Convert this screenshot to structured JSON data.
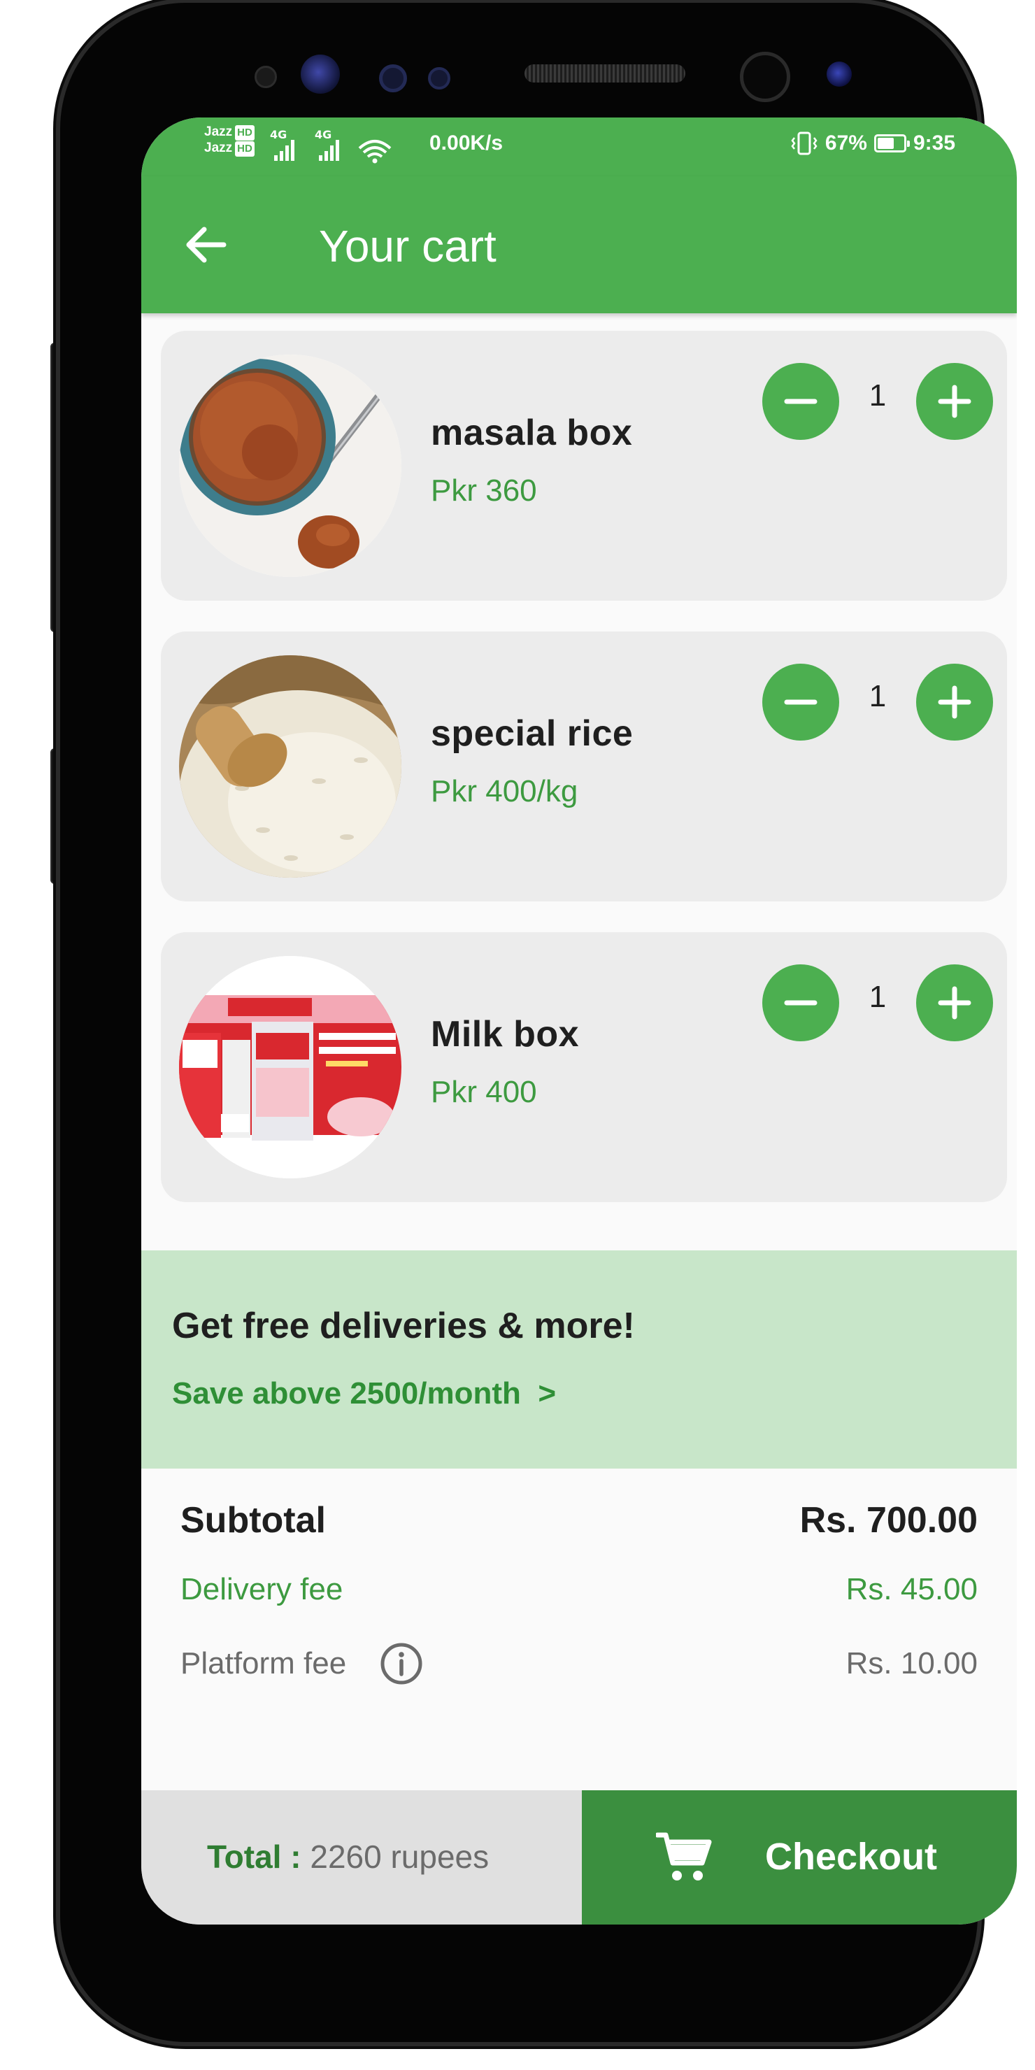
{
  "status_bar": {
    "carrier_1": "Jazz",
    "carrier_2": "Jazz",
    "hd_badge": "HD",
    "network_1": "4G",
    "network_2": "4G",
    "net_speed": "0.00K/s",
    "battery_percent": "67%",
    "battery_level": 0.67,
    "time": "9:35"
  },
  "header": {
    "title": "Your cart"
  },
  "cart": {
    "items": [
      {
        "name": "masala box",
        "price": "Pkr 360",
        "quantity": "1"
      },
      {
        "name": "special rice",
        "price": "Pkr 400/kg",
        "quantity": "1"
      },
      {
        "name": "Milk box",
        "price": "Pkr 400",
        "quantity": "1"
      }
    ]
  },
  "promo": {
    "title": "Get free deliveries & more!",
    "link": "Save above 2500/month  >"
  },
  "summary": {
    "subtotal_label": "Subtotal",
    "subtotal_value": "Rs. 700.00",
    "delivery_label": "Delivery fee",
    "delivery_value": "Rs. 45.00",
    "platform_label": "Platform fee",
    "platform_value": "Rs. 10.00"
  },
  "footer": {
    "total_label": "Total :",
    "total_value": "2260 rupees",
    "checkout_label": "Checkout"
  },
  "colors": {
    "primary": "#4caf50",
    "primary_dark": "#3b8f3f",
    "price_green": "#3d9a40",
    "promo_bg": "#c8e6c9",
    "card_bg": "#ececec"
  },
  "icons": {
    "back": "arrow-left-icon",
    "minus": "minus-icon",
    "plus": "plus-icon",
    "info": "info-icon",
    "cart": "shopping-cart-icon"
  }
}
